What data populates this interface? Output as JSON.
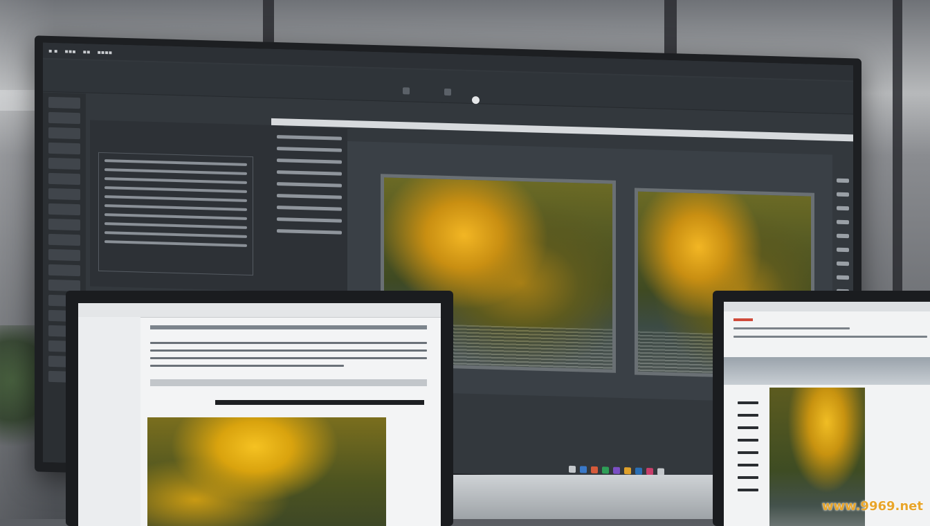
{
  "scene": {
    "description_icons": [
      "monitor-icon",
      "laptop-icon",
      "tablet-icon"
    ]
  },
  "watermark": {
    "text": "www.9969.net"
  },
  "colors": {
    "watermark": "#e8a52a",
    "photo_highlight": "#f2b624",
    "photo_shadow": "#3f4a22"
  }
}
